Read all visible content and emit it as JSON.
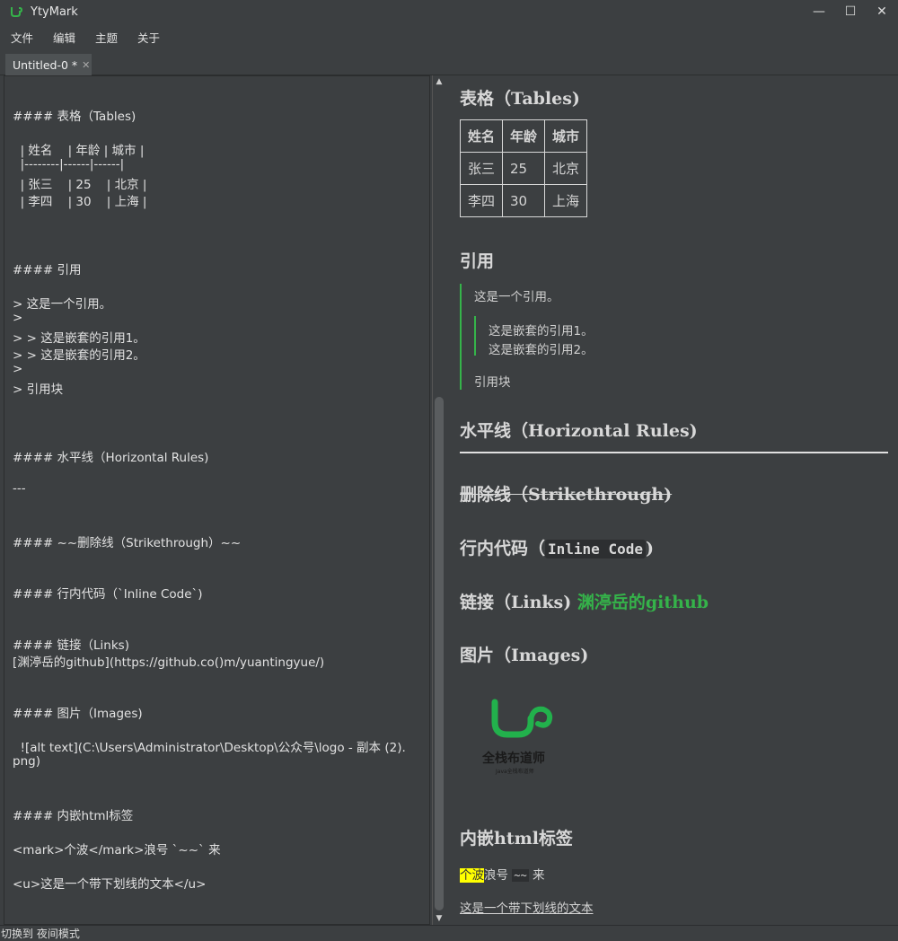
{
  "app": {
    "title": "YtyMark"
  },
  "menu": [
    "文件",
    "编辑",
    "主题",
    "关于"
  ],
  "tab": {
    "label": "Untitled-0 *",
    "close": "✕"
  },
  "editor": {
    "lines": [
      "#### 表格（Tables)",
      "  | 姓名    | 年龄 | 城市 |",
      "  |--------|------|------|",
      "  | 张三    | 25    | 北京 |",
      "  | 李四    | 30    | 上海 |",
      "#### 引用",
      "> 这是一个引用。",
      ">",
      "> > 这是嵌套的引用1。",
      "> > 这是嵌套的引用2。",
      ">",
      "> 引用块",
      "#### 水平线（Horizontal Rules)",
      "---",
      "#### ~~删除线（Strikethrough）~~",
      "#### 行内代码（`Inline Code`)",
      "#### 链接（Links)",
      "[渊渟岳的github](https://github.co()m/yuantingyue/)",
      "#### 图片（Images)",
      "  ![alt text](C:\\Users\\Administrator\\Desktop\\公众号\\logo - 副本 (2).",
      "png)",
      "#### 内嵌html标签",
      "<mark>个波</mark>浪号 `~~` 来",
      "<u>这是一个带下划线的文本</u>"
    ]
  },
  "preview": {
    "tables_heading": "表格（Tables)",
    "table": {
      "headers": [
        "姓名",
        "年龄",
        "城市"
      ],
      "rows": [
        [
          "张三",
          "25",
          "北京"
        ],
        [
          "李四",
          "30",
          "上海"
        ]
      ]
    },
    "quote_heading": "引用",
    "quote": {
      "line1": "这是一个引用。",
      "nested1": "这是嵌套的引用1。",
      "nested2": "这是嵌套的引用2。",
      "line2": "引用块"
    },
    "hr_heading": "水平线（Horizontal Rules)",
    "strike_heading": "删除线（Strikethrough)",
    "code_heading_pre": "行内代码（",
    "code_heading_code": "Inline Code",
    "code_heading_post": ")",
    "links_heading": "链接（Links)",
    "link_text": "渊渟岳的github",
    "images_heading": "图片（Images)",
    "logo": {
      "text": "全栈布道师",
      "sub": "Java全栈布道师"
    },
    "html_heading": "内嵌html标签",
    "mark_text": "个波",
    "after_mark": "浪号",
    "tilde_code": "~~",
    "after_tilde": "来",
    "underline_text": "这是一个带下划线的文本"
  },
  "status": {
    "text": "切换到 夜间模式"
  },
  "colors": {
    "accent": "#35b34a",
    "background": "#3c3f41",
    "mark": "#ffff00"
  }
}
